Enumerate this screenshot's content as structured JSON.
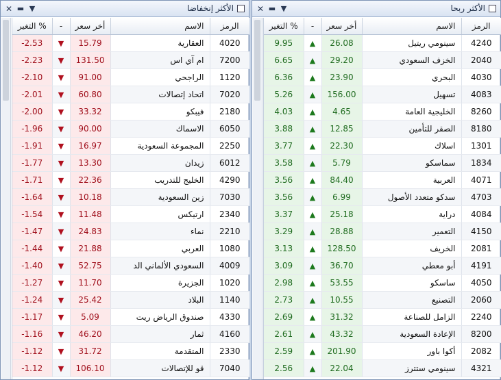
{
  "left_panel": {
    "title": "الأكثر إنخفاضا",
    "headers": {
      "change": "التغير %",
      "dash": "-",
      "price": "أخر سعر",
      "name": "الاسم",
      "symbol": "الرمز"
    },
    "rows": [
      {
        "change": "-2.53",
        "price": "15.79",
        "name": "العقارية",
        "symbol": "4020"
      },
      {
        "change": "-2.23",
        "price": "131.50",
        "name": "ام آي اس",
        "symbol": "7200"
      },
      {
        "change": "-2.10",
        "price": "91.00",
        "name": "الراجحي",
        "symbol": "1120"
      },
      {
        "change": "-2.01",
        "price": "60.80",
        "name": "اتحاد إتصالات",
        "symbol": "7020"
      },
      {
        "change": "-2.00",
        "price": "33.32",
        "name": "فيبكو",
        "symbol": "2180"
      },
      {
        "change": "-1.96",
        "price": "90.00",
        "name": "الاسماك",
        "symbol": "6050"
      },
      {
        "change": "-1.91",
        "price": "16.97",
        "name": "المجموعة السعودية",
        "symbol": "2250"
      },
      {
        "change": "-1.77",
        "price": "13.30",
        "name": "زيدان",
        "symbol": "6012"
      },
      {
        "change": "-1.71",
        "price": "22.36",
        "name": "الخليج للتدريب",
        "symbol": "4290"
      },
      {
        "change": "-1.64",
        "price": "10.18",
        "name": "زين السعودية",
        "symbol": "7030"
      },
      {
        "change": "-1.54",
        "price": "11.48",
        "name": "ارتيكس",
        "symbol": "2340"
      },
      {
        "change": "-1.47",
        "price": "24.83",
        "name": "نماء",
        "symbol": "2210"
      },
      {
        "change": "-1.44",
        "price": "21.88",
        "name": "العربي",
        "symbol": "1080"
      },
      {
        "change": "-1.40",
        "price": "52.75",
        "name": "السعودي الألماني الد",
        "symbol": "4009"
      },
      {
        "change": "-1.27",
        "price": "11.70",
        "name": "الجزيرة",
        "symbol": "1020"
      },
      {
        "change": "-1.24",
        "price": "25.42",
        "name": "البلاد",
        "symbol": "1140"
      },
      {
        "change": "-1.17",
        "price": "5.09",
        "name": "صندوق الرياض ريت",
        "symbol": "4330"
      },
      {
        "change": "-1.16",
        "price": "46.20",
        "name": "ثمار",
        "symbol": "4160"
      },
      {
        "change": "-1.12",
        "price": "31.72",
        "name": "المتقدمة",
        "symbol": "2330"
      },
      {
        "change": "-1.12",
        "price": "106.10",
        "name": "قو للإتصالات",
        "symbol": "7040"
      }
    ]
  },
  "right_panel": {
    "title": "الأكثر ربحا",
    "headers": {
      "change": "التغير %",
      "dash": "-",
      "price": "أخر سعر",
      "name": "الاسم",
      "symbol": "الرمز"
    },
    "rows": [
      {
        "change": "9.95",
        "price": "26.08",
        "name": "سينومي ريتيل",
        "symbol": "4240"
      },
      {
        "change": "6.65",
        "price": "29.20",
        "name": "الخزف السعودي",
        "symbol": "2040"
      },
      {
        "change": "6.36",
        "price": "23.90",
        "name": "البحري",
        "symbol": "4030"
      },
      {
        "change": "5.26",
        "price": "156.00",
        "name": "تسهيل",
        "symbol": "4083"
      },
      {
        "change": "4.03",
        "price": "4.65",
        "name": "الخليجية العامة",
        "symbol": "8260"
      },
      {
        "change": "3.88",
        "price": "12.85",
        "name": "الصقر للتأمين",
        "symbol": "8180"
      },
      {
        "change": "3.77",
        "price": "22.30",
        "name": "اسلاك",
        "symbol": "1301"
      },
      {
        "change": "3.58",
        "price": "5.79",
        "name": "سماسكو",
        "symbol": "1834"
      },
      {
        "change": "3.56",
        "price": "84.40",
        "name": "العربية",
        "symbol": "4071"
      },
      {
        "change": "3.56",
        "price": "6.99",
        "name": "سدكو متعدد الأصول",
        "symbol": "4703"
      },
      {
        "change": "3.37",
        "price": "25.18",
        "name": "دراية",
        "symbol": "4084"
      },
      {
        "change": "3.29",
        "price": "28.88",
        "name": "التعمير",
        "symbol": "4150"
      },
      {
        "change": "3.13",
        "price": "128.50",
        "name": "الخريف",
        "symbol": "2081"
      },
      {
        "change": "3.09",
        "price": "36.70",
        "name": "أبو معطي",
        "symbol": "4191"
      },
      {
        "change": "2.98",
        "price": "53.55",
        "name": "ساسكو",
        "symbol": "4050"
      },
      {
        "change": "2.73",
        "price": "10.55",
        "name": "التصنيع",
        "symbol": "2060"
      },
      {
        "change": "2.69",
        "price": "31.32",
        "name": "الزامل للصناعة",
        "symbol": "2240"
      },
      {
        "change": "2.61",
        "price": "43.32",
        "name": "الإعادة السعودية",
        "symbol": "8200"
      },
      {
        "change": "2.59",
        "price": "201.90",
        "name": "أكوا باور",
        "symbol": "2082"
      },
      {
        "change": "2.56",
        "price": "22.04",
        "name": "سينومي ستترز",
        "symbol": "4321"
      }
    ]
  },
  "icons": {
    "close": "close-icon",
    "minimize": "minimize-icon",
    "menu": "dropdown-menu-icon",
    "up": "arrow-up-icon",
    "down": "arrow-down-icon"
  },
  "colors": {
    "down_bg": "#fde9ea",
    "down_text": "#a0101c",
    "up_bg": "#e7f5e7",
    "up_text": "#1f6b1f"
  }
}
